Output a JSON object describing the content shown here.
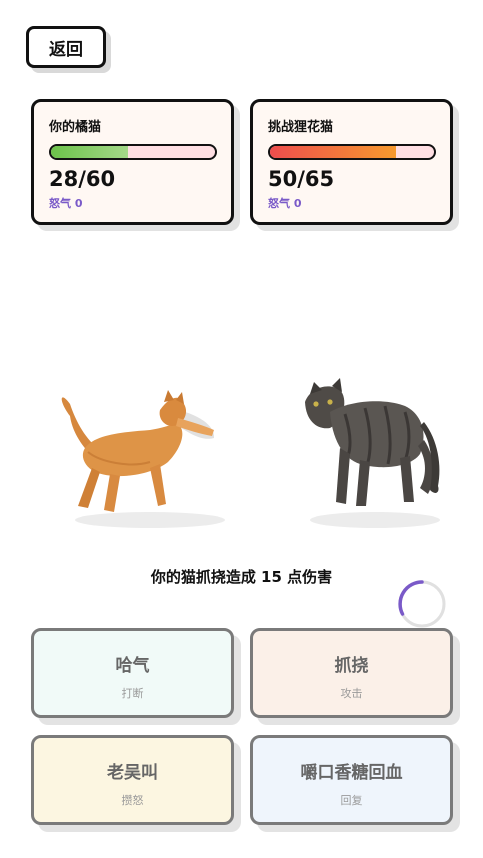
{
  "back_label": "返回",
  "player": {
    "name": "你的橘猫",
    "hp_text": "28/60",
    "hp_fraction": 0.4667,
    "rage_text": "怒气 0",
    "bar_color": "#6cc24a"
  },
  "enemy": {
    "name": "挑战狸花猫",
    "hp_text": "50/65",
    "hp_fraction": 0.7692,
    "rage_text": "怒气 0",
    "bar_color": "#ee4d4d"
  },
  "battle_message": "你的猫抓挠造成 15 点伤害",
  "actions": [
    {
      "title": "哈气",
      "sub": "打断",
      "bg": "#f1faf8"
    },
    {
      "title": "抓挠",
      "sub": "攻击",
      "bg": "#fbf0e8"
    },
    {
      "title": "老吴叫",
      "sub": "攒怒",
      "bg": "#fcf6e1"
    },
    {
      "title": "嚼口香糖回血",
      "sub": "回复",
      "bg": "#eff5fc"
    }
  ],
  "accent_color": "#7a5ac8"
}
